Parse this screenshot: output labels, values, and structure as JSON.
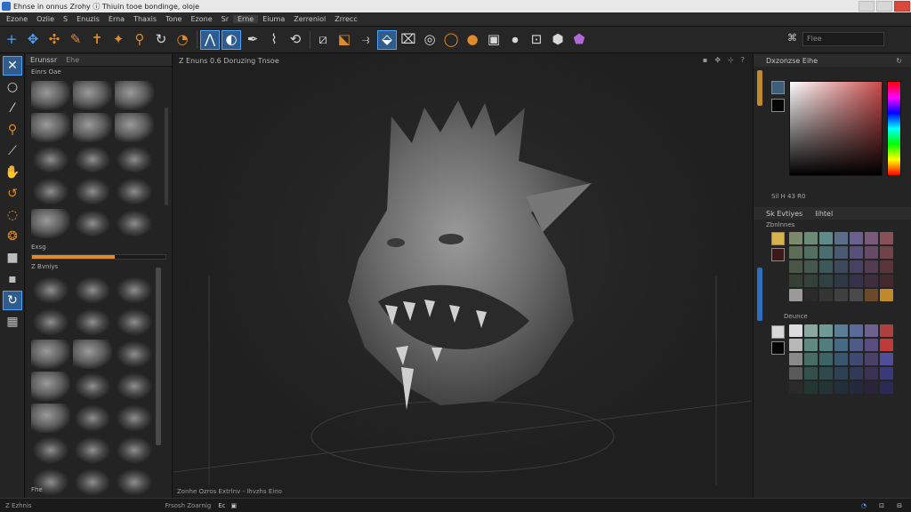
{
  "window": {
    "title": "Ehnse in onnus Zrohy  ⓘ  Thiuin tooe bondinge, oloje"
  },
  "menu": {
    "items": [
      "Ezone",
      "Ozlie",
      "S",
      "Enuzis",
      "Erna",
      "Thaxis",
      "Tone",
      "Ezone",
      "Sr",
      "Erne",
      "Eiuma",
      "Zerreniol",
      "Zrrecc"
    ]
  },
  "toolbar": {
    "filter_placeholder": "Flee"
  },
  "brush_panel": {
    "title": "Erunssr",
    "tab": "Ehe",
    "section_a": "Einrs  Oae",
    "section_b": "Exsg",
    "section_c": "Z Bvniys",
    "footer": "Fhe",
    "brush_size_fraction": 0.62
  },
  "viewport": {
    "title": "Z  Enuns  0.6  Doruzing  Tnsoe",
    "footer": "Zonhe   Ozros   Extrlnv   -   Ihvzhs  Eino"
  },
  "right_panel": {
    "color_title": "Dxzonzse  Eihe",
    "color_readout": "Sil  H  43  R0",
    "swatches_title": "Zbnlnnes",
    "swatches_tab_a": "Sk  Evtiyes",
    "swatches_tab_b": "Iihtel",
    "section2_label": "Deunce",
    "swatch_primary": "#3e5f7a",
    "swatch_secondary": "#050505",
    "palette1": [
      "#7a8a6a",
      "#6c8a78",
      "#5e8a8a",
      "#5a6e8a",
      "#6a6090",
      "#7a5a7a",
      "#8a5058",
      "#5e6e56",
      "#546e62",
      "#4a6e70",
      "#4a5a72",
      "#575078",
      "#664a66",
      "#724249",
      "#4a5646",
      "#44584e",
      "#3c5858",
      "#3c4a5c",
      "#464262",
      "#523c52",
      "#5a363c",
      "#364032",
      "#32423a",
      "#2e4242",
      "#2e3846",
      "#36324a",
      "#3e2e3e",
      "#442a2e",
      "#9a9a9a",
      "#2a2a2a",
      "#353535",
      "#404040",
      "#4a4a4a",
      "#6a4a2a",
      "#c08a2a"
    ],
    "palette2": [
      "#dcdcdc",
      "#8aa8a0",
      "#6e9a98",
      "#5a7e98",
      "#5a6a9a",
      "#6e6090",
      "#b04040",
      "#b8b8b8",
      "#5e8a80",
      "#4e7e80",
      "#466a84",
      "#4e5a88",
      "#5a4e80",
      "#c03a3a",
      "#8a8a8a",
      "#466e64",
      "#3c6466",
      "#385670",
      "#3e4a72",
      "#4a4068",
      "#4e4e9a",
      "#5a5a5a",
      "#34504a",
      "#2e4a4c",
      "#2c4254",
      "#303a56",
      "#3a3250",
      "#3a3a7a",
      "#2a2a2a",
      "#243632",
      "#223434",
      "#222e3a",
      "#24283c",
      "#2a2438",
      "#2a2a52"
    ]
  },
  "status": {
    "left": "Z  Ezhnis",
    "center": "Frsosh  Zoarnig",
    "center_icons": "Ec"
  }
}
